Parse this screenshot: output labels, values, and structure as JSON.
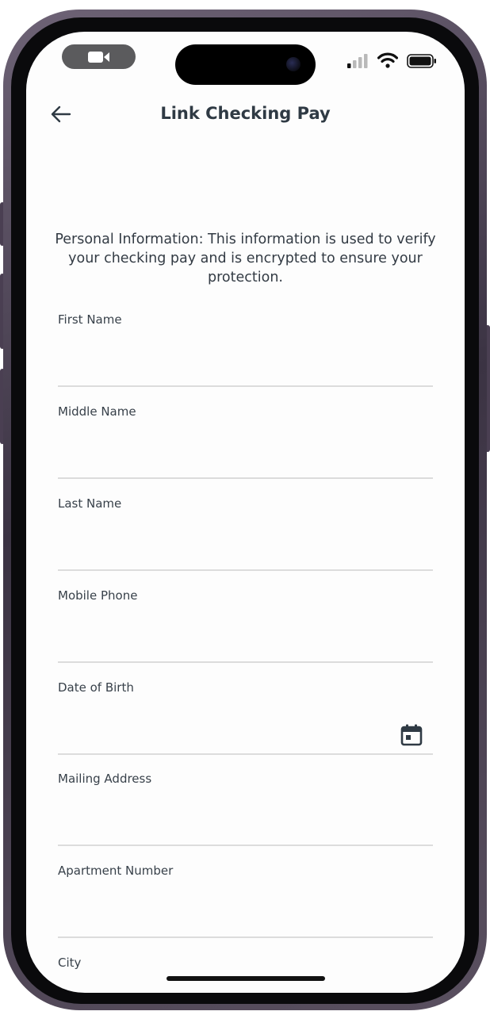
{
  "header": {
    "title": "Link Checking Pay",
    "back_icon": "arrow-left-icon"
  },
  "intro": {
    "text": "Personal Information: This information is used to verify your checking pay and is encrypted to ensure your protection."
  },
  "form": {
    "fields": [
      {
        "label": "First Name",
        "value": "",
        "placeholder": ""
      },
      {
        "label": "Middle Name",
        "value": "",
        "placeholder": ""
      },
      {
        "label": "Last Name",
        "value": "",
        "placeholder": ""
      },
      {
        "label": "Mobile Phone",
        "value": "",
        "placeholder": ""
      },
      {
        "label": "Date of Birth",
        "value": "",
        "placeholder": "",
        "icon": "calendar-icon"
      },
      {
        "label": "Mailing Address",
        "value": "",
        "placeholder": ""
      },
      {
        "label": "Apartment Number",
        "value": "",
        "placeholder": ""
      },
      {
        "label": "City",
        "value": "",
        "placeholder": ""
      }
    ]
  },
  "status_bar": {
    "icons": [
      "video-camera-icon",
      "signal-icon",
      "wifi-icon",
      "battery-icon"
    ]
  },
  "colors": {
    "title_text": "#2f3a44",
    "body_text": "#333b44",
    "divider": "#dcdcdc",
    "frame": "#3b3343"
  }
}
